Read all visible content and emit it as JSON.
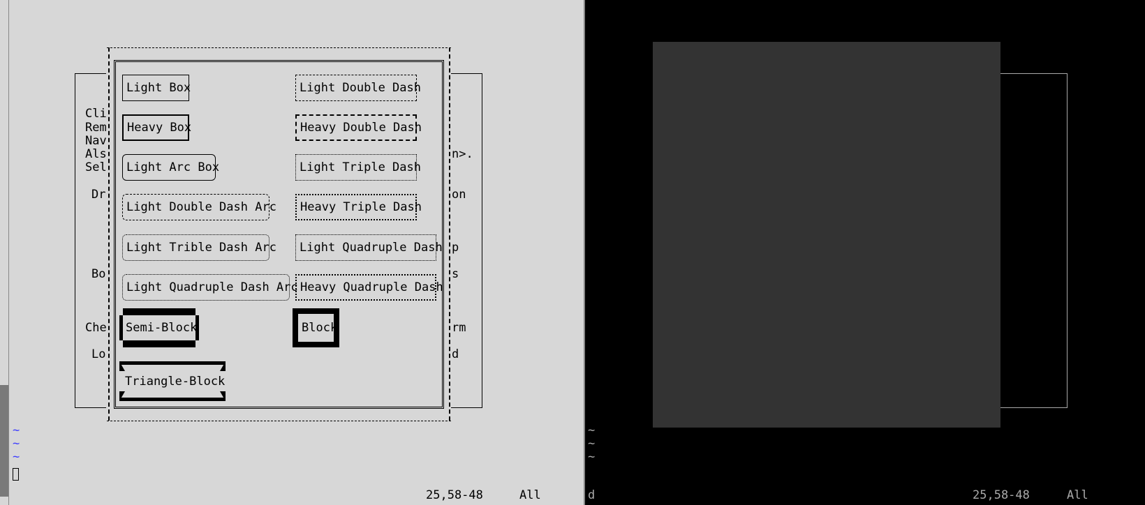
{
  "window": {
    "colors": {
      "light_bg": "#d7d7d7",
      "light_fg": "#000000",
      "dark_bg": "#000000",
      "dark_panel": "#333333",
      "dark_fg": "#aaaaaa",
      "tilde": "#3c3cff"
    }
  },
  "background_fragments": {
    "left": [
      "Cli",
      "Rem",
      "Nav",
      "Als",
      "Sel",
      "Dr",
      "Bo",
      "Che",
      "Lo"
    ],
    "right": [
      "n>.",
      "on",
      "p",
      "s",
      "rm",
      "d"
    ]
  },
  "boxes": {
    "light_box": "Light Box",
    "light_double_dash": "Light Double Dash",
    "heavy_box": "Heavy Box",
    "heavy_double_dash": "Heavy Double Dash",
    "light_arc_box": "Light Arc Box",
    "light_triple_dash": "Light Triple Dash",
    "light_double_dash_arc": "Light Double Dash Arc",
    "heavy_triple_dash": "Heavy Triple Dash",
    "light_trible_dash_arc": "Light Trible Dash Arc",
    "light_quadruple_dash": "Light Quadruple Dash",
    "light_quadruple_dash_arc": "Light Quadruple Dash Arc",
    "heavy_quadruple_dash": "Heavy Quadruple Dash",
    "semi_block": "Semi-Block",
    "block": "Block",
    "triangle_block": "Triangle-Block"
  },
  "editor": {
    "tilde": "~",
    "left_status_position": "25,58-48",
    "left_status_scroll": "All",
    "right_status_lead": "d",
    "right_status_position": "25,58-48",
    "right_status_scroll": "All"
  }
}
